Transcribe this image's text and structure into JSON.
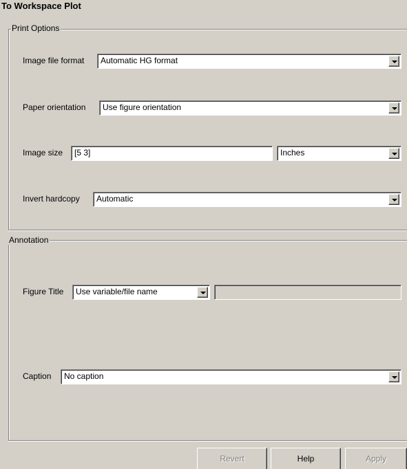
{
  "dialog": {
    "title": "To Workspace Plot"
  },
  "print_options": {
    "group_label": "Print Options",
    "image_file_format": {
      "label": "Image file format",
      "value": "Automatic HG format"
    },
    "paper_orientation": {
      "label": "Paper orientation",
      "value": "Use figure orientation"
    },
    "image_size": {
      "label": "Image size",
      "value": "[5 3]",
      "units_value": "Inches"
    },
    "invert_hardcopy": {
      "label": "Invert hardcopy",
      "value": "Automatic"
    }
  },
  "annotation": {
    "group_label": "Annotation",
    "figure_title": {
      "label": "Figure Title",
      "value": "Use variable/file name",
      "custom_value": ""
    },
    "caption": {
      "label": "Caption",
      "value": "No caption"
    }
  },
  "buttons": {
    "revert": {
      "label": "Revert",
      "enabled": false
    },
    "help": {
      "label": "Help",
      "enabled": true
    },
    "apply": {
      "label": "Apply",
      "enabled": false
    }
  },
  "icons": {
    "dropdown": "chevron-down-icon"
  }
}
